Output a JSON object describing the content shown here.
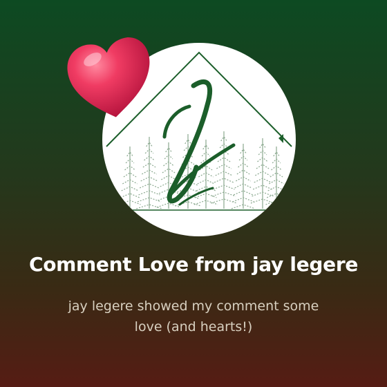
{
  "card": {
    "title": "Comment Love from jay legere",
    "subtitle_line1": "jay legere showed my comment some",
    "subtitle_line2": "love (and hearts!)"
  },
  "logo": {
    "icon": "jay-legere-house-trees-logo",
    "monogram_icon": "script-j-monogram"
  },
  "decorations": {
    "heart_icon": "heart-icon"
  },
  "colors": {
    "background_top": "#0d4a22",
    "background_bottom": "#561c14",
    "logo_green": "#1b5e2a",
    "heart": "#e0305a",
    "title": "#ffffff",
    "subtitle": "#d8d0c0"
  }
}
